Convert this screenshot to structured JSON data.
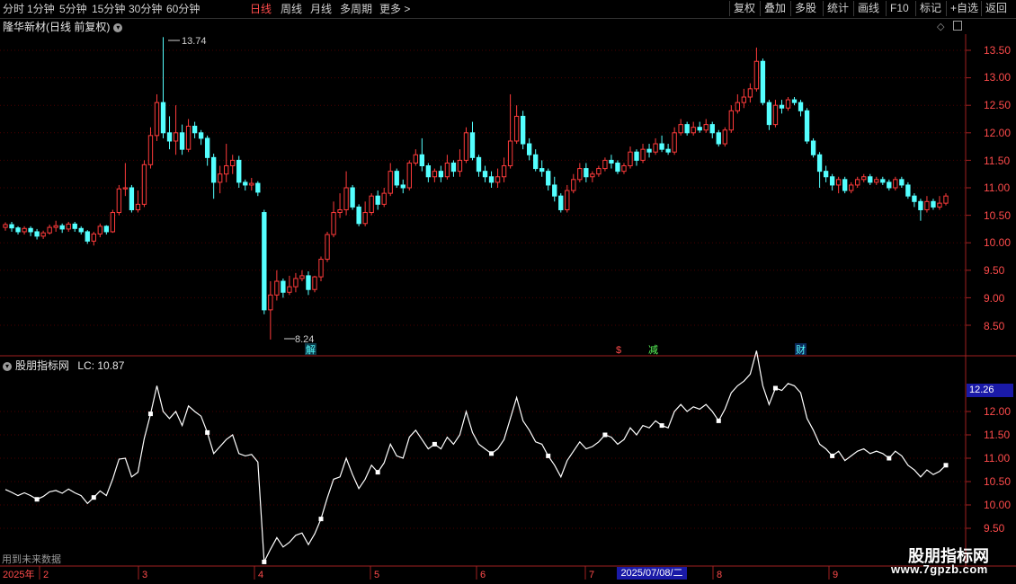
{
  "toolbar": {
    "periods": [
      "分时",
      "1分钟",
      "5分钟",
      "15分钟",
      "30分钟",
      "60分钟",
      "日线",
      "周线",
      "月线",
      "多周期",
      "更多 >"
    ],
    "active_period": "日线",
    "right_buttons": [
      "复权",
      "叠加",
      "多股",
      "统计",
      "画线",
      "F10",
      "标记",
      "+自选",
      "返回"
    ]
  },
  "main_chart": {
    "title": "隆华新材(日线 前复权)",
    "y_ticks": [
      "13.50",
      "13.00",
      "12.50",
      "12.00",
      "11.50",
      "11.00",
      "10.50",
      "10.00",
      "9.50",
      "9.00",
      "8.50"
    ],
    "high_label": "13.74",
    "low_label": "8.24",
    "markers": [
      "解",
      "$",
      "减",
      "财"
    ],
    "colors": {
      "up": "#ff3b3b",
      "down": "#54ffff",
      "grid": "#4a0000",
      "axis": "#a02020"
    }
  },
  "indicator": {
    "title": "股朋指标网",
    "lc_text": "LC: 10.87",
    "lc_value": "12.26",
    "y_ticks": [
      "12.00",
      "11.50",
      "11.00",
      "10.50",
      "10.00",
      "9.50"
    ],
    "future_note": "用到未来数据"
  },
  "time_axis": {
    "labels": [
      "2025年",
      "2",
      "3",
      "4",
      "5",
      "6",
      "7",
      "8",
      "9"
    ],
    "highlight": "2025/07/08/二"
  },
  "watermark": {
    "name": "股朋指标网",
    "url": "www.7gpzb.com"
  },
  "chart_data": {
    "type": "candlestick",
    "y_range": [
      8.2,
      13.8
    ],
    "candles": [
      [
        10.28,
        10.33,
        10.22,
        10.37
      ],
      [
        10.33,
        10.27,
        10.2,
        10.38
      ],
      [
        10.27,
        10.2,
        10.15,
        10.3
      ],
      [
        10.2,
        10.26,
        10.15,
        10.3
      ],
      [
        10.26,
        10.2,
        10.12,
        10.3
      ],
      [
        10.2,
        10.12,
        10.06,
        10.25
      ],
      [
        10.12,
        10.18,
        10.07,
        10.22
      ],
      [
        10.18,
        10.28,
        10.15,
        10.33
      ],
      [
        10.28,
        10.31,
        10.2,
        10.4
      ],
      [
        10.31,
        10.25,
        10.18,
        10.35
      ],
      [
        10.25,
        10.34,
        10.2,
        10.38
      ],
      [
        10.34,
        10.26,
        10.2,
        10.38
      ],
      [
        10.26,
        10.2,
        10.15,
        10.3
      ],
      [
        10.2,
        10.03,
        9.98,
        10.23
      ],
      [
        10.03,
        10.16,
        9.95,
        10.2
      ],
      [
        10.16,
        10.3,
        10.1,
        10.35
      ],
      [
        10.3,
        10.2,
        10.15,
        10.32
      ],
      [
        10.2,
        10.55,
        10.18,
        10.6
      ],
      [
        10.55,
        10.98,
        10.5,
        11.05
      ],
      [
        10.98,
        11.0,
        10.85,
        11.45
      ],
      [
        11.0,
        10.6,
        10.55,
        11.05
      ],
      [
        10.6,
        10.7,
        10.55,
        10.95
      ],
      [
        10.7,
        11.42,
        10.65,
        11.5
      ],
      [
        11.42,
        11.95,
        11.35,
        12.1
      ],
      [
        11.95,
        12.55,
        11.85,
        12.7
      ],
      [
        12.55,
        12.0,
        11.9,
        13.74
      ],
      [
        12.0,
        11.85,
        11.7,
        12.3
      ],
      [
        11.85,
        12.0,
        11.6,
        12.5
      ],
      [
        12.0,
        11.7,
        11.6,
        12.15
      ],
      [
        11.7,
        12.12,
        11.65,
        12.25
      ],
      [
        12.12,
        12.0,
        11.9,
        12.2
      ],
      [
        12.0,
        11.9,
        11.78,
        12.05
      ],
      [
        11.9,
        11.55,
        11.4,
        11.95
      ],
      [
        11.55,
        11.1,
        10.8,
        11.62
      ],
      [
        11.1,
        11.25,
        10.9,
        11.4
      ],
      [
        11.25,
        11.4,
        11.1,
        11.8
      ],
      [
        11.4,
        11.5,
        11.25,
        11.6
      ],
      [
        11.5,
        11.1,
        11.0,
        11.58
      ],
      [
        11.1,
        11.05,
        10.95,
        11.15
      ],
      [
        11.05,
        11.08,
        10.95,
        11.18
      ],
      [
        11.08,
        10.92,
        10.85,
        11.12
      ],
      [
        10.55,
        8.78,
        8.7,
        10.6
      ],
      [
        8.78,
        9.05,
        8.24,
        9.3
      ],
      [
        9.05,
        9.3,
        8.95,
        9.5
      ],
      [
        9.3,
        9.1,
        9.0,
        9.35
      ],
      [
        9.1,
        9.2,
        9.05,
        9.4
      ],
      [
        9.2,
        9.35,
        9.1,
        9.45
      ],
      [
        9.35,
        9.4,
        9.3,
        9.5
      ],
      [
        9.4,
        9.15,
        9.05,
        9.48
      ],
      [
        9.15,
        9.38,
        9.1,
        9.4
      ],
      [
        9.38,
        9.7,
        9.3,
        9.75
      ],
      [
        9.7,
        10.15,
        9.65,
        10.2
      ],
      [
        10.15,
        10.55,
        10.1,
        10.75
      ],
      [
        10.55,
        10.6,
        10.45,
        10.9
      ],
      [
        10.6,
        11.0,
        10.5,
        11.3
      ],
      [
        11.0,
        10.65,
        10.6,
        11.05
      ],
      [
        10.65,
        10.35,
        10.3,
        10.7
      ],
      [
        10.35,
        10.55,
        10.3,
        10.75
      ],
      [
        10.55,
        10.85,
        10.5,
        10.9
      ],
      [
        10.85,
        10.7,
        10.6,
        10.95
      ],
      [
        10.7,
        10.9,
        10.65,
        11.0
      ],
      [
        10.9,
        11.3,
        10.85,
        11.45
      ],
      [
        11.3,
        11.05,
        11.0,
        11.35
      ],
      [
        11.05,
        11.0,
        10.9,
        11.15
      ],
      [
        11.0,
        11.45,
        10.95,
        11.5
      ],
      [
        11.45,
        11.6,
        11.4,
        11.7
      ],
      [
        11.6,
        11.4,
        11.3,
        11.9
      ],
      [
        11.4,
        11.2,
        11.1,
        11.45
      ],
      [
        11.2,
        11.3,
        11.1,
        11.35
      ],
      [
        11.3,
        11.2,
        11.1,
        11.4
      ],
      [
        11.2,
        11.45,
        11.15,
        11.6
      ],
      [
        11.45,
        11.3,
        11.2,
        11.5
      ],
      [
        11.3,
        11.5,
        11.2,
        11.7
      ],
      [
        11.5,
        12.0,
        11.45,
        12.1
      ],
      [
        12.0,
        11.55,
        11.5,
        12.2
      ],
      [
        11.55,
        11.3,
        11.2,
        11.6
      ],
      [
        11.3,
        11.2,
        11.1,
        11.4
      ],
      [
        11.2,
        11.1,
        11.0,
        11.3
      ],
      [
        11.1,
        11.2,
        11.0,
        11.35
      ],
      [
        11.2,
        11.4,
        11.1,
        11.55
      ],
      [
        11.4,
        11.85,
        11.35,
        12.7
      ],
      [
        11.85,
        12.3,
        11.8,
        12.5
      ],
      [
        12.3,
        11.8,
        11.7,
        12.4
      ],
      [
        11.8,
        11.6,
        11.5,
        11.9
      ],
      [
        11.6,
        11.35,
        11.3,
        11.7
      ],
      [
        11.35,
        11.3,
        11.2,
        11.5
      ],
      [
        11.3,
        11.05,
        10.95,
        11.35
      ],
      [
        11.05,
        10.85,
        10.75,
        11.2
      ],
      [
        10.85,
        10.6,
        10.55,
        10.9
      ],
      [
        10.6,
        10.95,
        10.55,
        11.05
      ],
      [
        10.95,
        11.15,
        10.9,
        11.25
      ],
      [
        11.15,
        11.35,
        11.1,
        11.45
      ],
      [
        11.35,
        11.2,
        11.1,
        11.45
      ],
      [
        11.2,
        11.25,
        11.1,
        11.3
      ],
      [
        11.25,
        11.35,
        11.2,
        11.4
      ],
      [
        11.35,
        11.5,
        11.3,
        11.55
      ],
      [
        11.5,
        11.45,
        11.35,
        11.6
      ],
      [
        11.45,
        11.3,
        11.25,
        11.5
      ],
      [
        11.3,
        11.4,
        11.25,
        11.45
      ],
      [
        11.4,
        11.65,
        11.35,
        11.75
      ],
      [
        11.65,
        11.5,
        11.4,
        11.7
      ],
      [
        11.5,
        11.7,
        11.45,
        11.8
      ],
      [
        11.7,
        11.65,
        11.55,
        11.8
      ],
      [
        11.65,
        11.8,
        11.6,
        11.9
      ],
      [
        11.8,
        11.7,
        11.65,
        11.95
      ],
      [
        11.7,
        11.65,
        11.6,
        11.8
      ],
      [
        11.65,
        12.0,
        11.6,
        12.1
      ],
      [
        12.0,
        12.15,
        11.95,
        12.25
      ],
      [
        12.15,
        12.0,
        11.95,
        12.2
      ],
      [
        12.0,
        12.1,
        11.95,
        12.2
      ],
      [
        12.1,
        12.05,
        12.0,
        12.2
      ],
      [
        12.05,
        12.15,
        12.0,
        12.25
      ],
      [
        12.15,
        12.0,
        11.9,
        12.2
      ],
      [
        12.0,
        11.8,
        11.75,
        12.05
      ],
      [
        11.8,
        12.05,
        11.75,
        12.1
      ],
      [
        12.05,
        12.4,
        12.0,
        12.5
      ],
      [
        12.4,
        12.55,
        12.35,
        12.7
      ],
      [
        12.55,
        12.65,
        12.45,
        12.8
      ],
      [
        12.65,
        12.8,
        12.55,
        12.9
      ],
      [
        12.8,
        13.3,
        12.75,
        13.55
      ],
      [
        13.3,
        12.55,
        12.5,
        13.35
      ],
      [
        12.55,
        12.15,
        12.05,
        12.6
      ],
      [
        12.15,
        12.5,
        12.1,
        12.6
      ],
      [
        12.5,
        12.45,
        12.35,
        12.6
      ],
      [
        12.45,
        12.6,
        12.4,
        12.65
      ],
      [
        12.6,
        12.55,
        12.5,
        12.65
      ],
      [
        12.55,
        12.4,
        12.3,
        12.6
      ],
      [
        12.4,
        11.85,
        11.8,
        12.45
      ],
      [
        11.85,
        11.6,
        11.55,
        11.9
      ],
      [
        11.6,
        11.3,
        11.0,
        11.65
      ],
      [
        11.3,
        11.2,
        11.1,
        11.4
      ],
      [
        11.2,
        11.05,
        10.95,
        11.25
      ],
      [
        11.05,
        11.15,
        10.9,
        11.2
      ],
      [
        11.15,
        10.95,
        10.9,
        11.2
      ],
      [
        10.95,
        11.05,
        10.9,
        11.1
      ],
      [
        11.05,
        11.15,
        11.0,
        11.2
      ],
      [
        11.15,
        11.2,
        11.1,
        11.25
      ],
      [
        11.2,
        11.1,
        11.05,
        11.25
      ],
      [
        11.1,
        11.15,
        11.05,
        11.2
      ],
      [
        11.15,
        11.1,
        11.05,
        11.2
      ],
      [
        11.1,
        11.0,
        10.95,
        11.15
      ],
      [
        11.0,
        11.15,
        10.95,
        11.2
      ],
      [
        11.15,
        11.05,
        11.0,
        11.2
      ],
      [
        11.05,
        10.85,
        10.8,
        11.1
      ],
      [
        10.85,
        10.75,
        10.65,
        10.9
      ],
      [
        10.75,
        10.6,
        10.4,
        10.8
      ],
      [
        10.6,
        10.75,
        10.55,
        10.85
      ],
      [
        10.75,
        10.65,
        10.6,
        10.8
      ],
      [
        10.65,
        10.72,
        10.6,
        10.85
      ],
      [
        10.72,
        10.85,
        10.68,
        10.9
      ]
    ]
  }
}
